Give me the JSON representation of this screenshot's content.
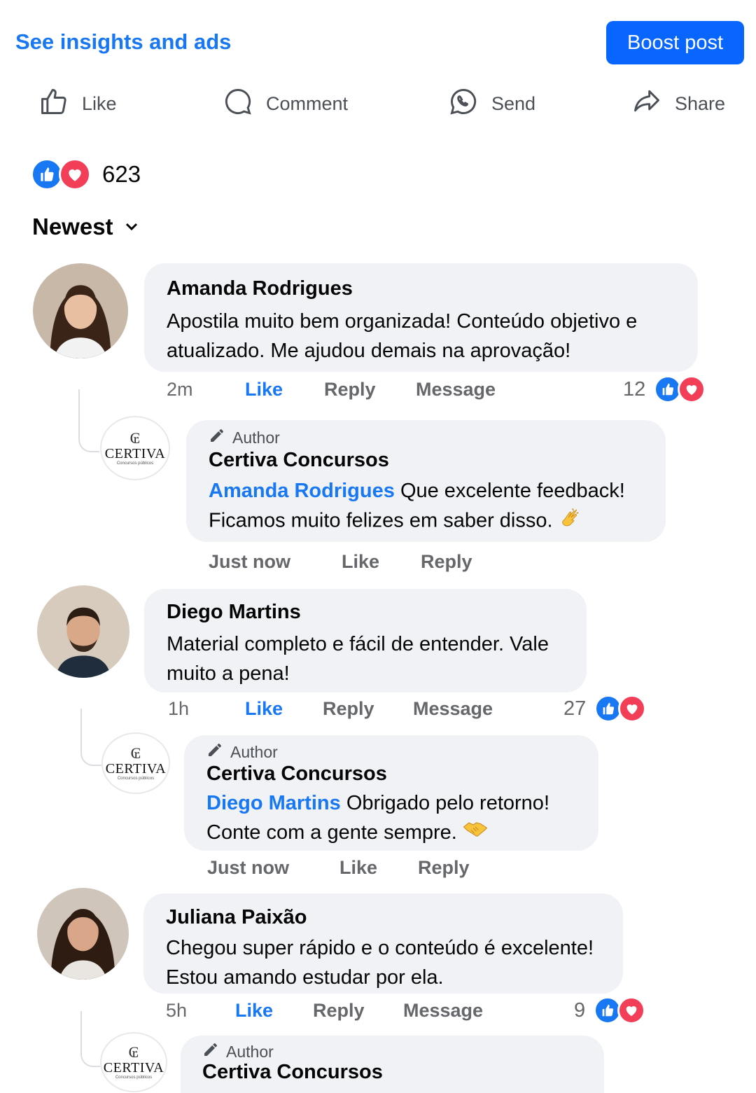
{
  "header": {
    "insights_link": "See insights and ads",
    "boost_button": "Boost post"
  },
  "actions": {
    "like": "Like",
    "comment": "Comment",
    "send": "Send",
    "share": "Share"
  },
  "reactions": {
    "count": "623",
    "types": [
      "like-icon",
      "love-icon"
    ]
  },
  "sort": {
    "label": "Newest"
  },
  "colors": {
    "accent": "#1877f2",
    "boost": "#0866ff",
    "love": "#f33e58",
    "bubble": "#f0f2f5"
  },
  "comments": [
    {
      "name": "Amanda Rodrigues",
      "text": "Apostila muito bem organizada! Conteúdo objetivo e atualizado. Me ajudou demais na aprovação!",
      "time": "2m",
      "like": "Like",
      "reply": "Reply",
      "message": "Message",
      "reaction_count": "12",
      "reply_comment": {
        "tag": "Author",
        "name": "Certiva Concursos",
        "mention": "Amanda Rodrigues",
        "text": "Que excelente feedback! Ficamos muito felizes em saber disso.",
        "emoji": "clapping-hands",
        "time": "Just now",
        "like": "Like",
        "reply": "Reply"
      }
    },
    {
      "name": "Diego Martins",
      "text": "Material completo e fácil de entender. Vale muito a pena!",
      "time": "1h",
      "like": "Like",
      "reply": "Reply",
      "message": "Message",
      "reaction_count": "27",
      "reply_comment": {
        "tag": "Author",
        "name": "Certiva Concursos",
        "mention": "Diego Martins",
        "text": "Obrigado pelo retorno! Conte com a gente sempre.",
        "emoji": "handshake",
        "time": "Just now",
        "like": "Like",
        "reply": "Reply"
      }
    },
    {
      "name": "Juliana Paixão",
      "text": "Chegou super rápido e o conteúdo é excelente! Estou amando estudar por ela.",
      "time": "5h",
      "like": "Like",
      "reply": "Reply",
      "message": "Message",
      "reaction_count": "9",
      "reply_comment": {
        "tag": "Author",
        "name": "Certiva Concursos"
      }
    }
  ],
  "page_logo": {
    "brand": "CERTIVA",
    "sub": "Concursos públicos"
  }
}
